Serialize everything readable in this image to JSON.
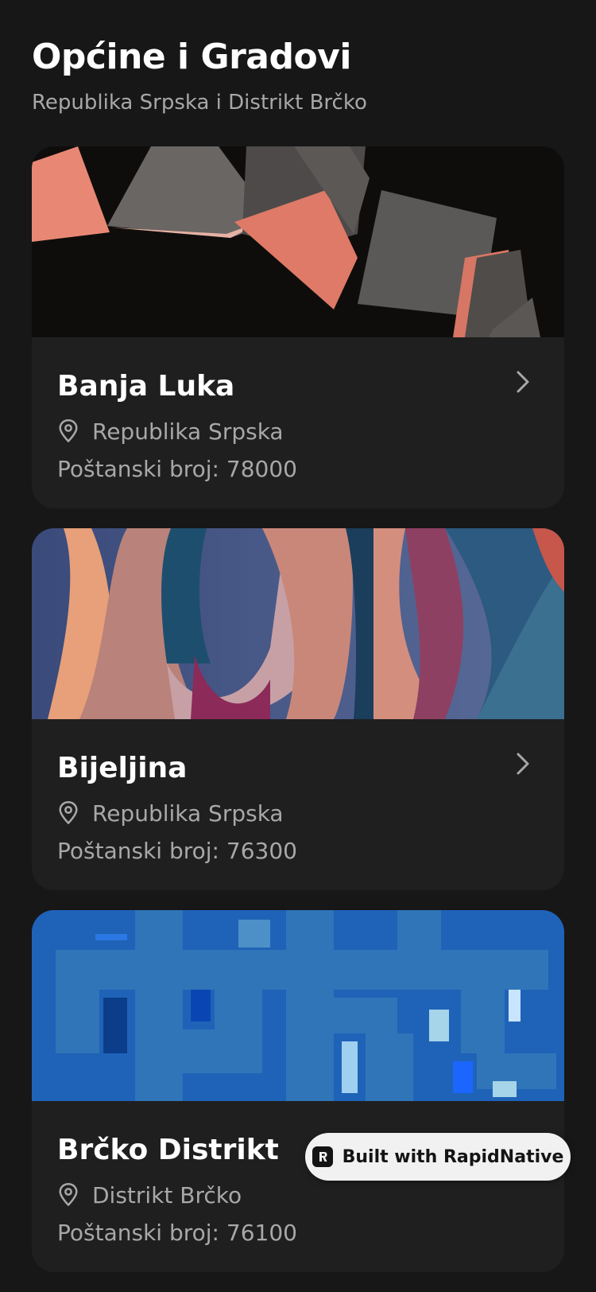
{
  "header": {
    "title": "Općine i Gradovi",
    "subtitle": "Republika Srpska i Distrikt Brčko"
  },
  "cards": [
    {
      "name": "Banja Luka",
      "region": "Republika Srpska",
      "postal": "Poštanski broj: 78000",
      "icon": "map-pin-icon",
      "chevron": "chevron-right-icon"
    },
    {
      "name": "Bijeljina",
      "region": "Republika Srpska",
      "postal": "Poštanski broj: 76300",
      "icon": "map-pin-icon",
      "chevron": "chevron-right-icon"
    },
    {
      "name": "Brčko Distrikt",
      "region": "Distrikt Brčko",
      "postal": "Poštanski broj: 76100",
      "icon": "map-pin-icon"
    }
  ],
  "badge": {
    "label": "Built with RapidNative"
  },
  "colors": {
    "background": "#171717",
    "card": "#1f1f1f",
    "muted_text": "#a8a8a8"
  }
}
